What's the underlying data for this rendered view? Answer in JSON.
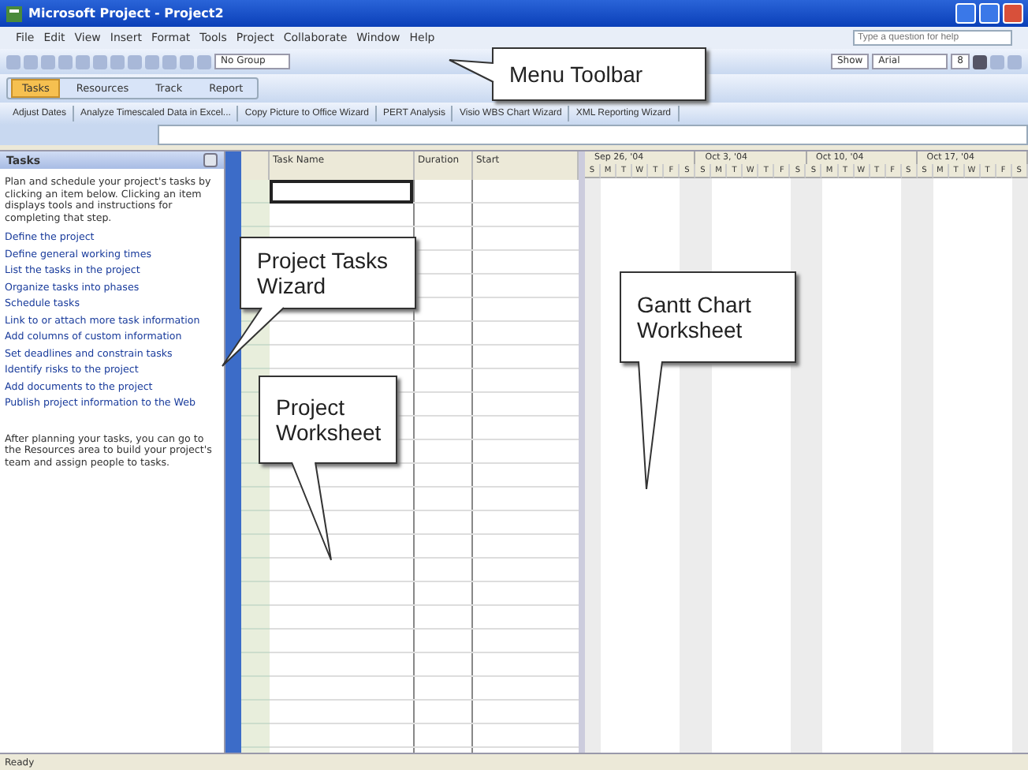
{
  "window": {
    "title": "Microsoft Project - Project2"
  },
  "menu": [
    "File",
    "Edit",
    "View",
    "Insert",
    "Format",
    "Tools",
    "Project",
    "Collaborate",
    "Window",
    "Help"
  ],
  "help_box": {
    "placeholder": "Type a question for help"
  },
  "standard_toolbar": {
    "group": "No Group",
    "show": "Show",
    "font": "Arial",
    "size": "8"
  },
  "guide_toolbar": [
    {
      "label": "Tasks",
      "selected": true
    },
    {
      "label": "Resources",
      "selected": false
    },
    {
      "label": "Track",
      "selected": false
    },
    {
      "label": "Report",
      "selected": false
    }
  ],
  "analysis_toolbar": [
    "Adjust Dates",
    "Analyze Timescaled Data in Excel...",
    "Copy Picture to Office Wizard",
    "PERT Analysis",
    "Visio WBS Chart Wizard",
    "XML Reporting Wizard"
  ],
  "tasks_pane": {
    "title": "Tasks",
    "intro": "Plan and schedule your project's tasks by clicking an item below. Clicking an item displays tools and instructions for completing that step.",
    "items": [
      "Define the project",
      "Define general working times",
      "List the tasks in the project",
      "Organize tasks into phases",
      "Schedule tasks",
      "Link to or attach more task information",
      "Add columns of custom information",
      "Set deadlines and constrain tasks",
      "Identify risks to the project",
      "Add documents to the project",
      "Publish project information to the Web"
    ],
    "footer": "After planning your tasks, you can go to the Resources area to build your project's team and assign people to tasks."
  },
  "table": {
    "columns": [
      "Task Name",
      "Duration",
      "Start"
    ]
  },
  "gantt": {
    "weeks": [
      {
        "label": "Sep 26, '04",
        "days": [
          "S",
          "M",
          "T",
          "W",
          "T",
          "F",
          "S"
        ]
      },
      {
        "label": "Oct 3, '04",
        "days": [
          "S",
          "M",
          "T",
          "W",
          "T",
          "F",
          "S"
        ]
      },
      {
        "label": "Oct 10, '04",
        "days": [
          "S",
          "M",
          "T",
          "W",
          "T",
          "F",
          "S"
        ]
      },
      {
        "label": "Oct 17, '04",
        "days": [
          "S",
          "M",
          "T",
          "W",
          "T",
          "F",
          "S"
        ]
      }
    ]
  },
  "callouts": [
    {
      "text": "Menu Toolbar"
    },
    {
      "text": "Project Tasks Wizard"
    },
    {
      "text": "Project Worksheet"
    },
    {
      "text": "Gantt Chart Worksheet"
    }
  ],
  "status_bar": {
    "text": "Ready"
  }
}
